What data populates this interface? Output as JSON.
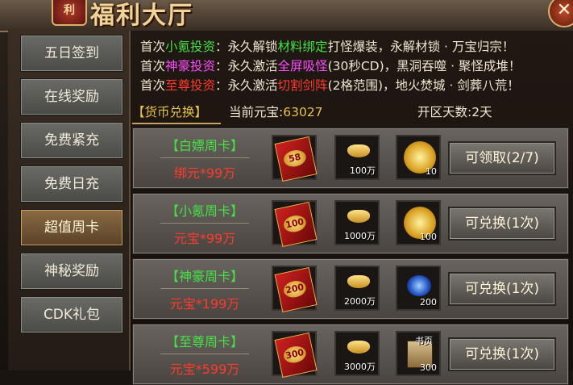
{
  "window": {
    "title": "福利大厅",
    "emblem": "利",
    "close_label": "✕"
  },
  "sidebar": {
    "items": [
      {
        "label": "五日签到"
      },
      {
        "label": "在线奖励"
      },
      {
        "label": "免费紧充"
      },
      {
        "label": "免费日充"
      },
      {
        "label": "超值周卡",
        "active": true
      },
      {
        "label": "神秘奖励"
      },
      {
        "label": "CDK礼包"
      }
    ]
  },
  "announce": {
    "lines": [
      {
        "prefix": "首次",
        "name": "小氪投资",
        "name_color": "green",
        "mid": "：永久解锁",
        "hl": "材料绑定",
        "hl_color": "green",
        "suffix": "打怪爆装，永解材锁 · 万宝归宗！"
      },
      {
        "prefix": "首次",
        "name": "神豪投资",
        "name_color": "magenta",
        "mid": "：永久激活",
        "hl": "全屏吸怪",
        "hl_color": "magenta",
        "suffix": "(30秒CD)，黑洞吞噬 · 聚怪成堆！"
      },
      {
        "prefix": "首次",
        "name": "至尊投资",
        "name_color": "red",
        "mid": "：永久激活",
        "hl": "切割剑阵",
        "hl_color": "red",
        "suffix": "(2格范围)，地火焚城 · 剑葬八荒！"
      }
    ]
  },
  "info": {
    "tab_label": "【货币兑换】",
    "yuanbao_label": "当前元宝:",
    "yuanbao_value": "63027",
    "days_label": "开区天数:",
    "days_value": "2天"
  },
  "cards": [
    {
      "name": "【白嫖周卡】",
      "price": "绑元*99万",
      "packet": "58",
      "ingot_count": "100万",
      "third_type": "gold-orb",
      "third_count": "10",
      "button": "可领取(2/7)"
    },
    {
      "name": "【小氪周卡】",
      "price": "元宝*99万",
      "packet": "100",
      "ingot_count": "1000万",
      "third_type": "gold-orb",
      "third_count": "100",
      "button": "可兑换(1次)"
    },
    {
      "name": "【神豪周卡】",
      "price": "元宝*199万",
      "packet": "200",
      "ingot_count": "2000万",
      "third_type": "blue-gem",
      "third_count": "200",
      "button": "可兑换(1次)"
    },
    {
      "name": "【至尊周卡】",
      "price": "元宝*599万",
      "packet": "300",
      "ingot_count": "3000万",
      "third_type": "book",
      "third_label": "书页",
      "third_count": "300",
      "button": "可兑换(1次)"
    }
  ]
}
